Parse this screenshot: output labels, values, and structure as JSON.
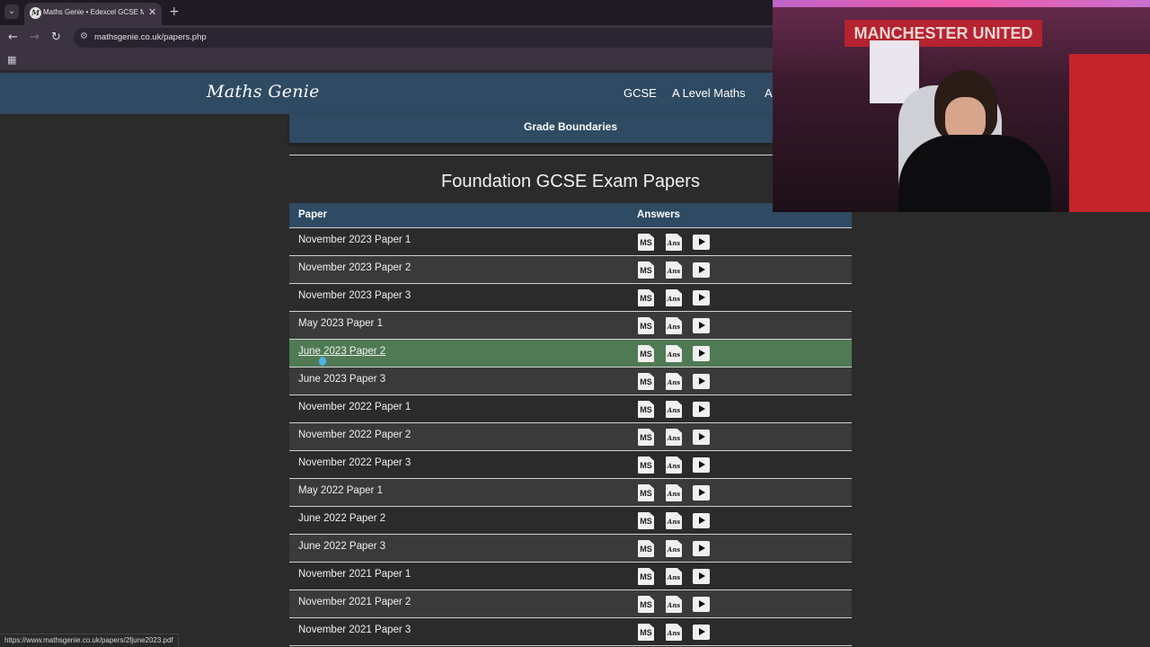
{
  "browser": {
    "tab_title": "Maths Genie • Edexcel GCSE M…",
    "favicon_letter": "M",
    "url": "mathsgenie.co.uk/papers.php",
    "status_url": "https://www.mathsgenie.co.uk/papers/2fjune2023.pdf"
  },
  "site": {
    "logo": "Maths Genie",
    "nav": [
      "GCSE",
      "A Level Maths",
      "A"
    ],
    "subnav_label": "Grade Boundaries"
  },
  "page": {
    "title": "Foundation GCSE Exam Papers",
    "table_headers": {
      "paper": "Paper",
      "answers": "Answers"
    },
    "icon_labels": {
      "ms": "MS",
      "ans": "Ans"
    },
    "rows": [
      "November 2023 Paper 1",
      "November 2023 Paper 2",
      "November 2023 Paper 3",
      "May 2023 Paper 1",
      "June 2023 Paper 2",
      "June 2023 Paper 3",
      "November 2022 Paper 1",
      "November 2022 Paper 2",
      "November 2022 Paper 3",
      "May 2022 Paper 1",
      "June 2022 Paper 2",
      "June 2022 Paper 3",
      "November 2021 Paper 1",
      "November 2021 Paper 2",
      "November 2021 Paper 3"
    ],
    "hovered_row": 4
  },
  "webcam": {
    "banner": "MANCHESTER UNITED"
  },
  "colors": {
    "header": "#2f4a63",
    "hover_row": "#4f7a54",
    "background": "#2b2b2b"
  }
}
